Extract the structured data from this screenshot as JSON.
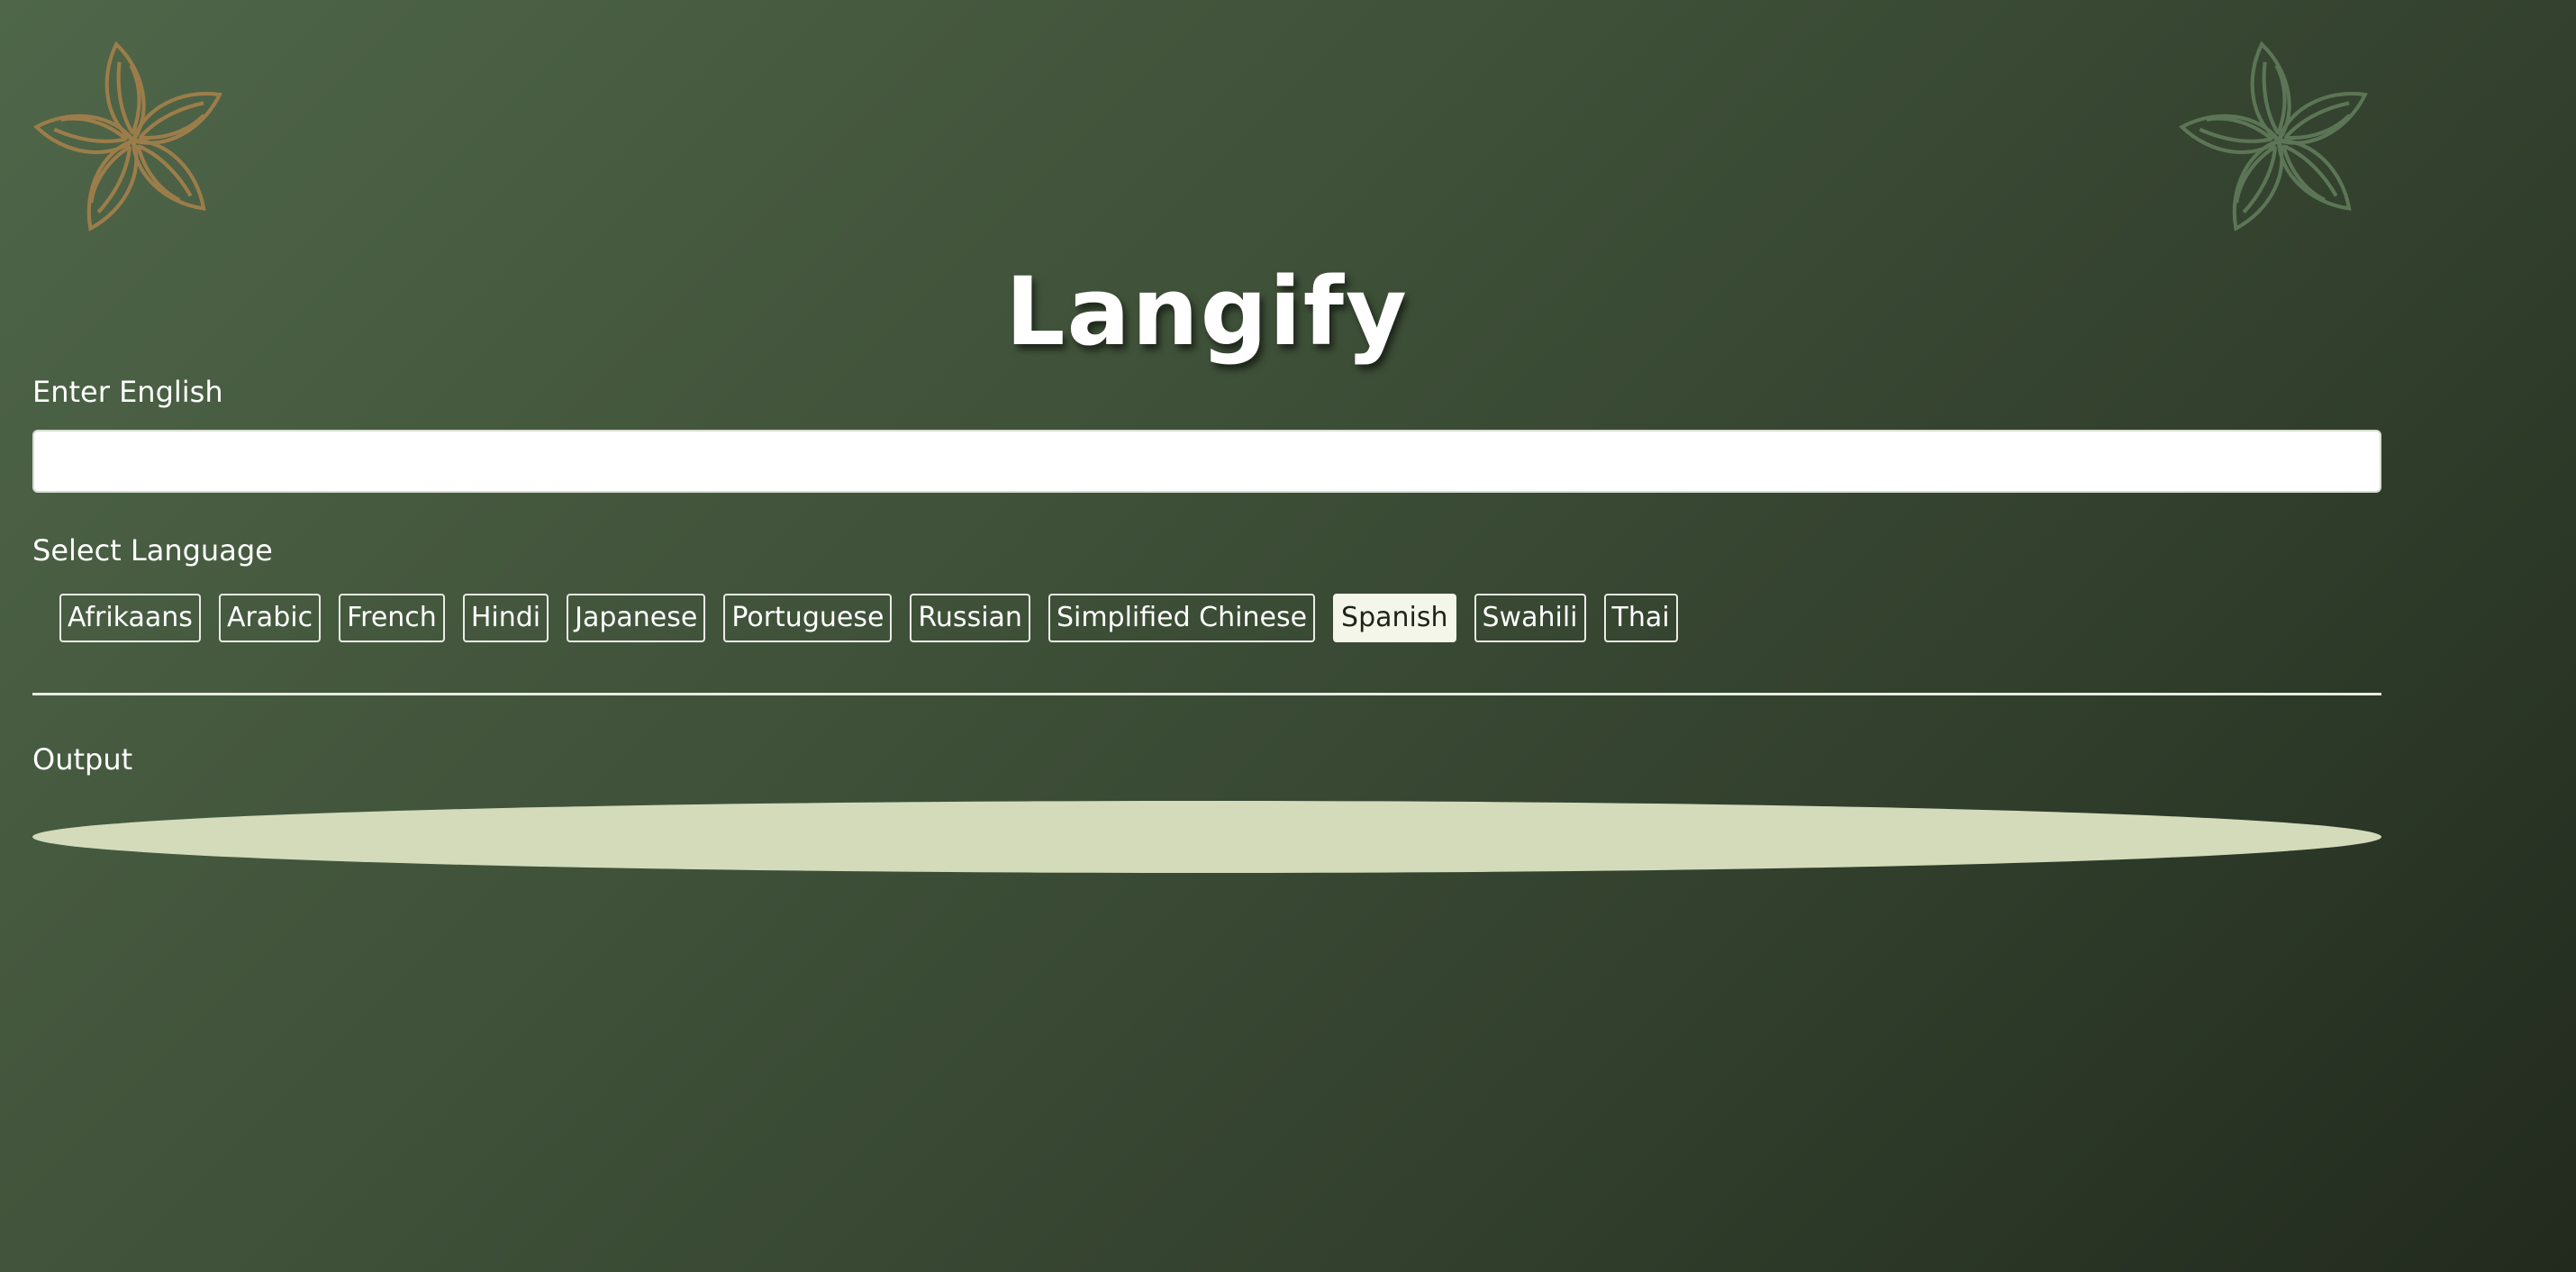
{
  "app": {
    "title": "Langify"
  },
  "decorations": {
    "left_icon": "flower-icon",
    "right_icon": "flower-icon",
    "left_color": "#9c7d4a",
    "right_color": "#5c7556"
  },
  "input": {
    "label": "Enter English",
    "value": "",
    "placeholder": ""
  },
  "languages": {
    "label": "Select Language",
    "selected": "Spanish",
    "options": [
      "Afrikaans",
      "Arabic",
      "French",
      "Hindi",
      "Japanese",
      "Portuguese",
      "Russian",
      "Simplified Chinese",
      "Spanish",
      "Swahili",
      "Thai"
    ]
  },
  "output": {
    "label": "Output",
    "value": ""
  },
  "colors": {
    "background_start": "#4f6649",
    "background_end": "#222a1e",
    "selected_button_bg": "#f4f6ea",
    "output_bg": "#d3dbbb"
  }
}
